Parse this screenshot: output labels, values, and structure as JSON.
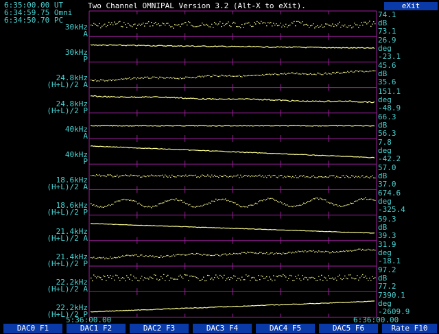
{
  "header": {
    "time_ut": "6:35:00.00 UT",
    "time_omni": "6:34:59.75 Omni",
    "time_pc": "6:34:50.70 PC",
    "title": "Two Channel OMNIPAL Version 3.2 (Alt-X to eXit).",
    "exit_label": "eXit"
  },
  "channels": [
    {
      "label1": "30kHz",
      "label2": "A",
      "top": "74.1",
      "unit": "dB",
      "bottom": "73.1"
    },
    {
      "label1": "30kHz",
      "label2": "P",
      "top": "26.9",
      "unit": "deg",
      "bottom": "-23.1"
    },
    {
      "label1": "24.8kHz",
      "label2": "(H+L)/2 A",
      "top": "45.6",
      "unit": "dB",
      "bottom": "35.6"
    },
    {
      "label1": "24.8kHz",
      "label2": "(H+L)/2 P",
      "top": "151.1",
      "unit": "deg",
      "bottom": "-48.9"
    },
    {
      "label1": "40kHz",
      "label2": "A",
      "top": "66.3",
      "unit": "dB",
      "bottom": "56.3"
    },
    {
      "label1": "40kHz",
      "label2": "P",
      "top": "7.8",
      "unit": "deg",
      "bottom": "-42.2"
    },
    {
      "label1": "18.6kHz",
      "label2": "(H+L)/2 A",
      "top": "57.0",
      "unit": "dB",
      "bottom": "37.0"
    },
    {
      "label1": "18.6kHz",
      "label2": "(H+L)/2 P",
      "top": "674.6",
      "unit": "deg",
      "bottom": "-325.4"
    },
    {
      "label1": "21.4kHz",
      "label2": "(H+L)/2 A",
      "top": "59.3",
      "unit": "dB",
      "bottom": "39.3"
    },
    {
      "label1": "21.4kHz",
      "label2": "(H+L)/2 P",
      "top": "31.9",
      "unit": "deg",
      "bottom": "-18.1"
    },
    {
      "label1": "22.2kHz",
      "label2": "(H+L)/2 A",
      "top": "97.2",
      "unit": "dB",
      "bottom": "77.2"
    },
    {
      "label1": "22.2kHz",
      "label2": "(H+L)/2 P",
      "top": "7390.1",
      "unit": "deg",
      "bottom": "-2609.9"
    }
  ],
  "time_axis": {
    "start": "5:36:00.00",
    "end": "6:36:00.00"
  },
  "fkeys": [
    "DAC0 F1",
    "DAC1 F2",
    "DAC2 F3",
    "DAC3 F4",
    "DAC4 F5",
    "DAC5 F6",
    "Rate F10"
  ],
  "colors": {
    "trace": "#ffff90",
    "grid": "#a020a0",
    "label": "#4ad4d4",
    "button": "#0a3aa8"
  }
}
